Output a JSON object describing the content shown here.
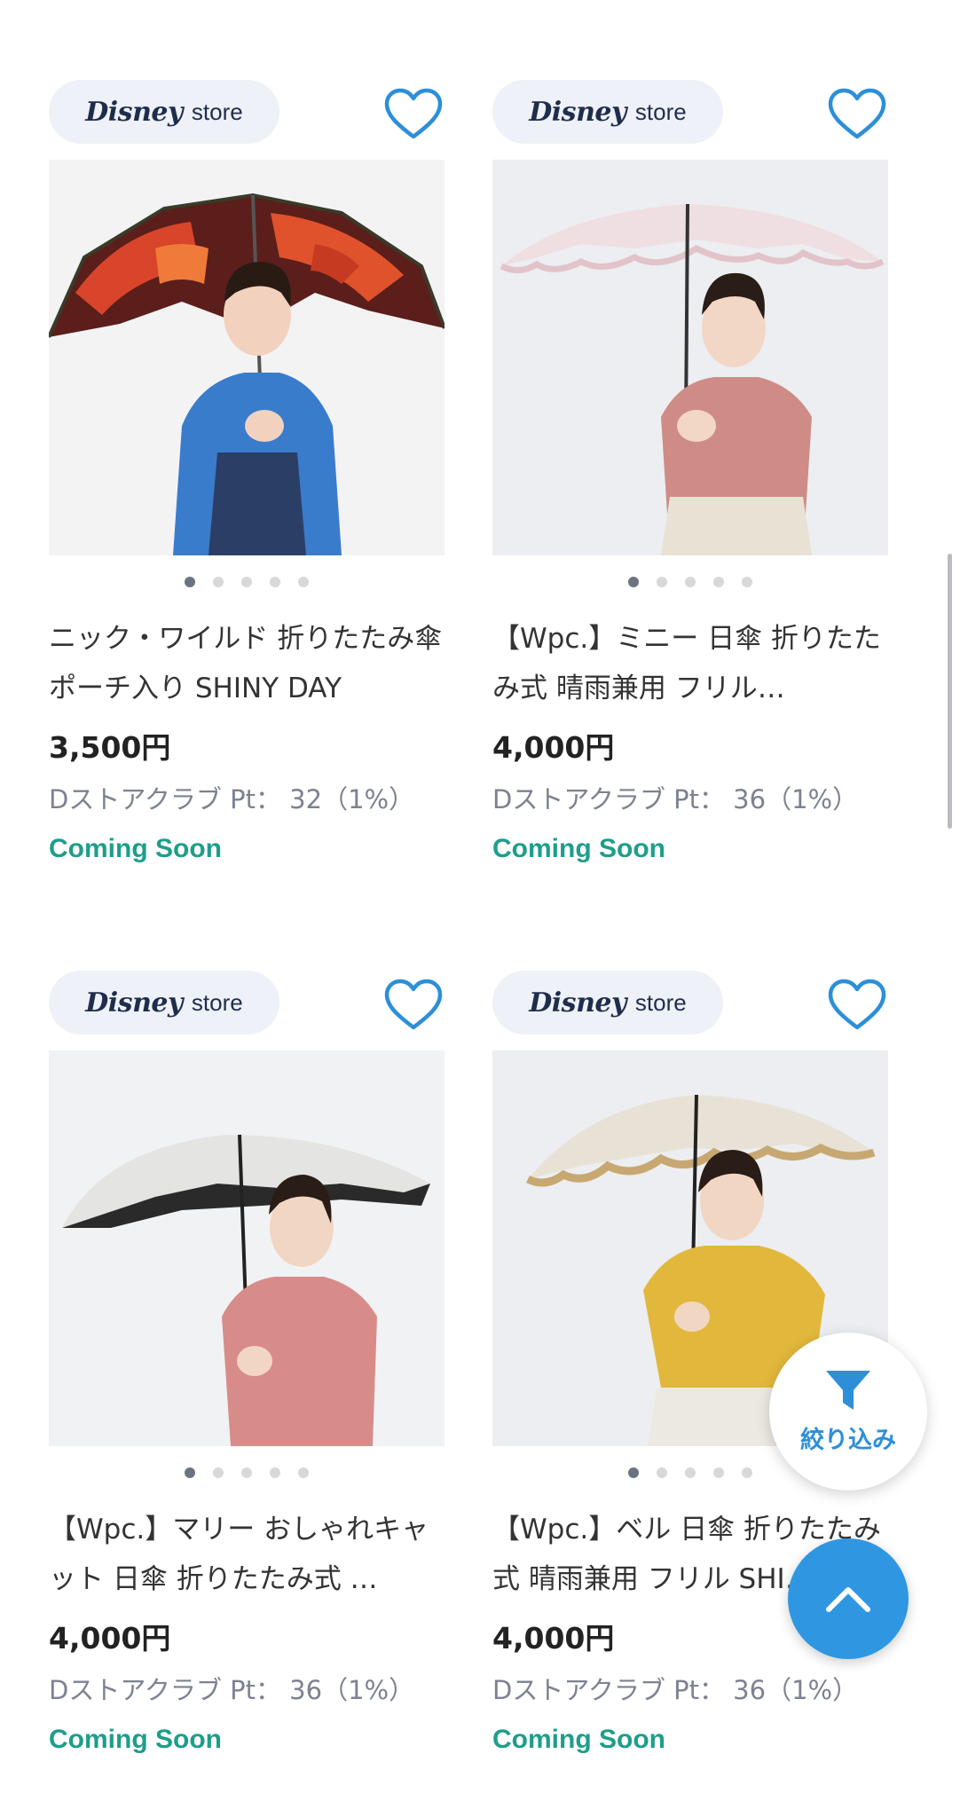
{
  "store_badge": {
    "logo": "Disney",
    "word": "store"
  },
  "colors": {
    "accent_blue": "#2f97e2",
    "heart_blue": "#2c8fd8",
    "coming_soon_green": "#1e9e8a",
    "badge_bg": "#eef1f7"
  },
  "icons": {
    "favorite": "heart-outline-icon",
    "filter": "funnel-icon",
    "scroll_top": "chevron-up-icon"
  },
  "products": [
    {
      "title": "ニック・ワイルド 折りたたみ傘 ポーチ入り SHINY DAY",
      "price": "3,500円",
      "points": "Dストアクラブ Pt： 32（1%）",
      "status": "Coming Soon",
      "image_count": 5,
      "active_image": 1
    },
    {
      "title": "【Wpc.】ミニー 日傘 折りたたみ式 晴雨兼用 フリル…",
      "price": "4,000円",
      "points": "Dストアクラブ Pt： 36（1%）",
      "status": "Coming Soon",
      "image_count": 5,
      "active_image": 1
    },
    {
      "title": "【Wpc.】マリー おしゃれキャット 日傘 折りたたみ式 …",
      "price": "4,000円",
      "points": "Dストアクラブ Pt： 36（1%）",
      "status": "Coming Soon",
      "image_count": 5,
      "active_image": 1
    },
    {
      "title": "【Wpc.】ベル 日傘 折りたたみ式 晴雨兼用 フリル SHI…",
      "price": "4,000円",
      "points": "Dストアクラブ Pt： 36（1%）",
      "status": "Coming Soon",
      "image_count": 5,
      "active_image": 1
    }
  ],
  "filter_button": {
    "label": "絞り込み"
  }
}
